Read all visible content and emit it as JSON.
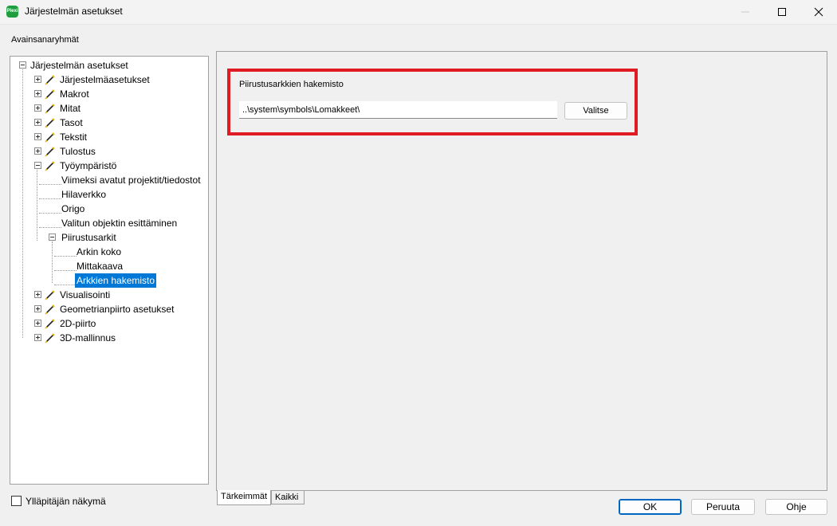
{
  "window": {
    "title": "Järjestelmän asetukset",
    "app_icon_text": "Plexi"
  },
  "left": {
    "group_label": "Avainsanaryhmät",
    "admin_view_label": "Ylläpitäjän näkymä",
    "admin_view_checked": false
  },
  "tree": {
    "root": "Järjestelmän asetukset",
    "nodes": [
      "Järjestelmäasetukset",
      "Makrot",
      "Mitat",
      "Tasot",
      "Tekstit",
      "Tulostus",
      "Työympäristö",
      "Viimeksi avatut projektit/tiedostot",
      "Hilaverkko",
      "Origo",
      "Valitun objektin esittäminen",
      "Piirustusarkit",
      "Arkin koko",
      "Mittakaava",
      "Arkkien hakemisto",
      "Visualisointi",
      "Geometrianpiirto asetukset",
      "2D-piirto",
      "3D-mallinnus"
    ],
    "selected": "Arkkien hakemisto"
  },
  "settings": {
    "field_label": "Piirustusarkkien hakemisto",
    "path_value": "..\\system\\symbols\\Lomakkeet\\",
    "select_button": "Valitse"
  },
  "tabs": {
    "important": "Tärkeimmät",
    "all": "Kaikki",
    "active": "Tärkeimmät"
  },
  "buttons": {
    "ok": "OK",
    "cancel": "Peruuta",
    "help": "Ohje"
  },
  "colors": {
    "highlight_box": "#e01b24",
    "selection": "#0078d7",
    "app_icon": "#1e9e3e"
  }
}
